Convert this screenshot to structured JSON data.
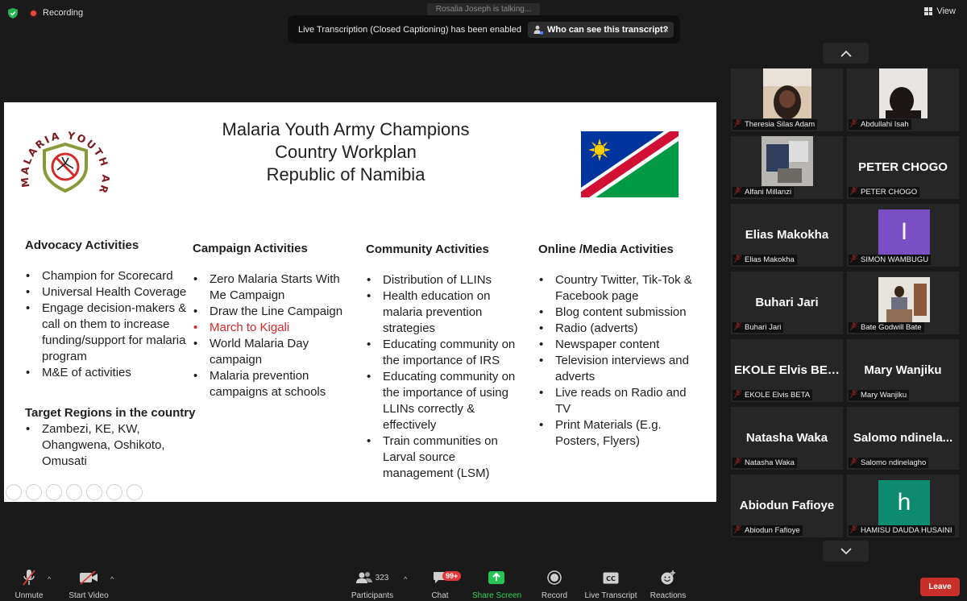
{
  "topbar": {
    "recording_label": "Recording",
    "view_label": "View",
    "talking_label": "Rosalia Joseph is talking...",
    "notice_text": "Live Transcription (Closed Captioning) has been enabled",
    "notice_link": "Who can see this transcript?",
    "notice_close": "×"
  },
  "slide": {
    "logo_text": "MALARIA YOUTH ARMY",
    "title_lines": [
      "Malaria Youth Army Champions",
      "Country  Workplan",
      "Republic of Namibia"
    ],
    "advocacy": {
      "heading": "Advocacy Activities",
      "items": [
        "Champion for Scorecard",
        "Universal Health Coverage",
        "Engage decision-makers & call on them to increase funding/support for malaria program",
        "M&E of activities"
      ]
    },
    "target": {
      "heading": "Target Regions in the country",
      "items": [
        "Zambezi, KE, KW, Ohangwena, Oshikoto, Omusati"
      ]
    },
    "campaign": {
      "heading": "Campaign  Activities",
      "items": [
        "Zero Malaria Starts With Me Campaign",
        "Draw the Line Campaign",
        "March to Kigali",
        "World Malaria Day campaign",
        "Malaria prevention campaigns at schools"
      ]
    },
    "community": {
      "heading": "Community   Activities",
      "items": [
        "Distribution of LLINs",
        "Health education on malaria prevention strategies",
        "Educating community on the importance of IRS",
        "Educating community on the importance of using LLINs correctly & effectively",
        "Train communities on Larval source management (LSM)"
      ]
    },
    "online": {
      "heading": "Online /Media   Activities",
      "items": [
        "Country Twitter, Tik-Tok & Facebook page",
        "Blog content submission",
        "Radio (adverts)",
        "Newspaper content",
        "Television interviews and adverts",
        "Live reads on Radio and TV",
        "Print Materials (E.g. Posters, Flyers)"
      ]
    },
    "highlight_color": "#d7272a"
  },
  "participants": [
    {
      "display": "",
      "caption": "Theresia Silas Adam",
      "kind": "photo"
    },
    {
      "display": "",
      "caption": "Abdullahi Isah",
      "kind": "photo"
    },
    {
      "display": "",
      "caption": "Alfani Millanzi",
      "kind": "photo"
    },
    {
      "display": "PETER CHOGO",
      "caption": "PETER CHOGO",
      "kind": "name"
    },
    {
      "display": "Elias Makokha",
      "caption": "Elias Makokha",
      "kind": "name"
    },
    {
      "display": "I",
      "caption": "SIMON WAMBUGU",
      "kind": "letter",
      "color": "#7a4fc4"
    },
    {
      "display": "Buhari Jari",
      "caption": "Buhari Jari",
      "kind": "name"
    },
    {
      "display": "",
      "caption": "Bate Godwill Bate",
      "kind": "photo"
    },
    {
      "display": "EKOLE Elvis BETA",
      "caption": "EKOLE Elvis BETA",
      "kind": "name"
    },
    {
      "display": "Mary Wanjiku",
      "caption": "Mary Wanjiku",
      "kind": "name"
    },
    {
      "display": "Natasha Waka",
      "caption": "Natasha Waka",
      "kind": "name"
    },
    {
      "display": "Salomo  ndinela...",
      "caption": "Salomo ndinelagho",
      "kind": "name"
    },
    {
      "display": "Abiodun Fafioye",
      "caption": "Abiodun Fafioye",
      "kind": "name"
    },
    {
      "display": "h",
      "caption": "HAMISU DAUDA HUSAINI",
      "kind": "letter",
      "color": "#0e8a6e"
    }
  ],
  "toolbar": {
    "unmute": "Unmute",
    "start_video": "Start Video",
    "participants": "Participants",
    "participant_count": "323",
    "chat": "Chat",
    "chat_badge": "99+",
    "share_screen": "Share Screen",
    "record": "Record",
    "live_transcript": "Live Transcript",
    "reactions": "Reactions",
    "leave": "Leave"
  }
}
